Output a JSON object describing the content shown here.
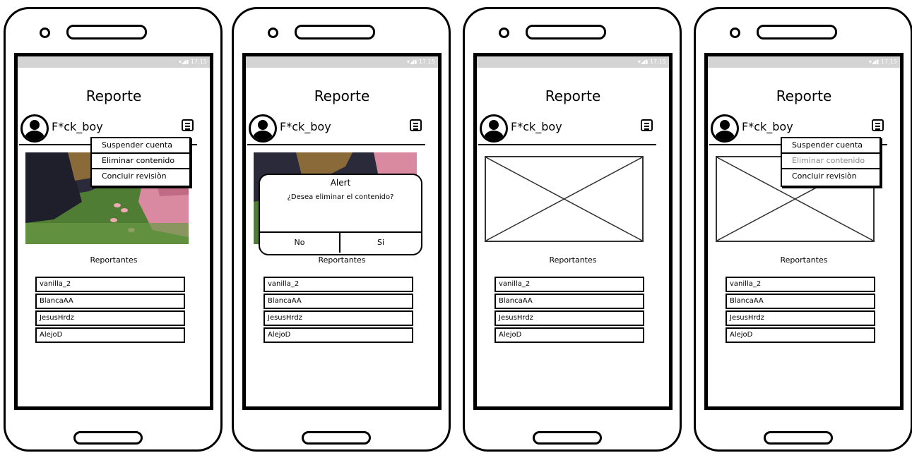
{
  "status_bar": {
    "time": "17:15"
  },
  "screens": [
    {
      "title": "Reporte",
      "username": "F*ck_boy",
      "reportantes_label": "Reportantes",
      "reporters": [
        "vanilla_2",
        "BlancaAA",
        "JesusHrdz",
        "AlejoD"
      ],
      "menu": {
        "items": [
          "Suspender cuenta",
          "Eliminar contenido",
          "Concluir revisiòn"
        ]
      }
    },
    {
      "title": "Reporte",
      "username": "F*ck_boy",
      "reportantes_label": "Reportantes",
      "reporters": [
        "vanilla_2",
        "BlancaAA",
        "JesusHrdz",
        "AlejoD"
      ],
      "alert": {
        "title": "Alert",
        "message": "¿Desea eliminar el contenido?",
        "no": "No",
        "yes": "Si"
      }
    },
    {
      "title": "Reporte",
      "username": "F*ck_boy",
      "reportantes_label": "Reportantes",
      "reporters": [
        "vanilla_2",
        "BlancaAA",
        "JesusHrdz",
        "AlejoD"
      ]
    },
    {
      "title": "Reporte",
      "username": "F*ck_boy",
      "reportantes_label": "Reportantes",
      "reporters": [
        "vanilla_2",
        "BlancaAA",
        "JesusHrdz",
        "AlejoD"
      ],
      "menu": {
        "items": [
          "Suspender cuenta",
          "Eliminar contenido",
          "Concluir revisiòn"
        ],
        "disabled_index": 1
      }
    }
  ]
}
